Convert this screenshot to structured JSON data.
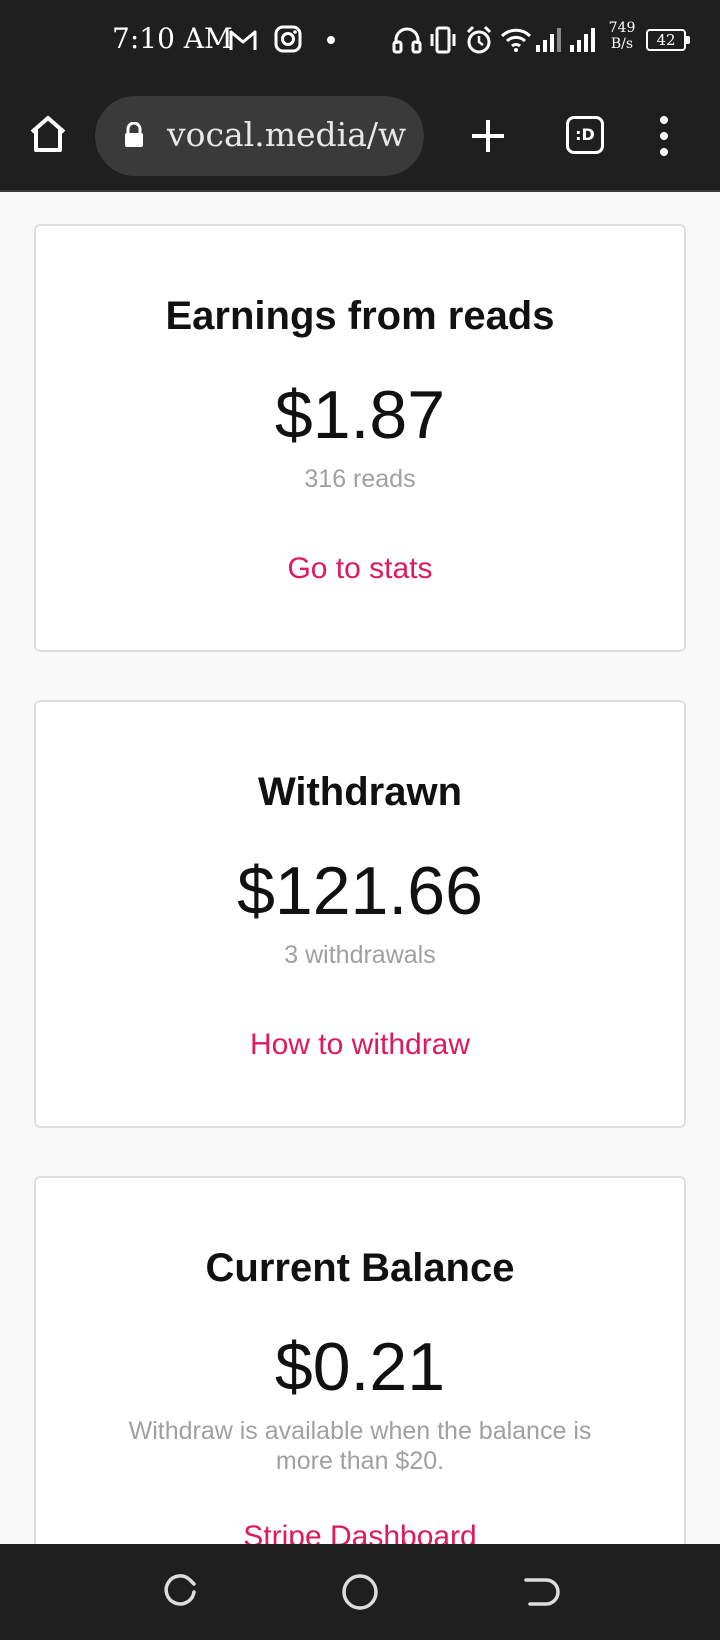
{
  "status_bar": {
    "time": "7:10 AM",
    "net_speed_value": "749",
    "net_speed_unit": "B/s",
    "battery": "42",
    "icons": [
      "gmail-icon",
      "instagram-icon",
      "dot-icon",
      "headset-icon",
      "vibrate-icon",
      "alarm-icon",
      "wifi-icon",
      "signal-icon",
      "signal-icon",
      "battery-icon"
    ]
  },
  "browser": {
    "url": "vocal.media/w",
    "tabs_label": ":D"
  },
  "cards": [
    {
      "title": "Earnings from reads",
      "amount": "$1.87",
      "subtext": "316 reads",
      "link": "Go to stats"
    },
    {
      "title": "Withdrawn",
      "amount": "$121.66",
      "subtext": "3 withdrawals",
      "link": "How to withdraw"
    },
    {
      "title": "Current Balance",
      "amount": "$0.21",
      "subtext": "Withdraw is available when the balance is more than $20.",
      "link": "Stripe Dashboard"
    }
  ],
  "colors": {
    "accent": "#e0185e",
    "chrome_bg": "#1f1f1f",
    "page_bg": "#f9f9f9"
  }
}
